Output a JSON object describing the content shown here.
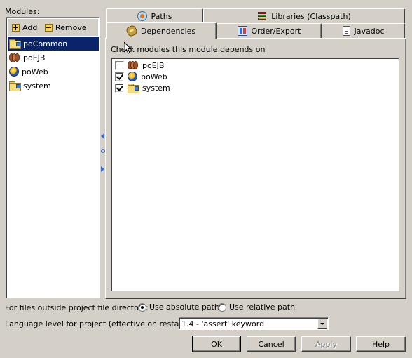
{
  "modules": {
    "label": "Modules:",
    "add_label": "Add",
    "remove_label": "Remove",
    "items": [
      {
        "name": "poCommon",
        "icon": "folder-module-icon",
        "selected": true
      },
      {
        "name": "poEJB",
        "icon": "ejb-beans-icon"
      },
      {
        "name": "poWeb",
        "icon": "web-globe-icon"
      },
      {
        "name": "system",
        "icon": "folder-module-icon"
      }
    ]
  },
  "tabs": {
    "paths": "Paths",
    "libraries": "Libraries (Classpath)",
    "dependencies": "Dependencies",
    "order_export": "Order/Export",
    "javadoc": "Javadoc",
    "active": "Dependencies"
  },
  "dependencies": {
    "label": "Check modules this module depends on",
    "items": [
      {
        "name": "poEJB",
        "checked": false
      },
      {
        "name": "poWeb",
        "checked": true
      },
      {
        "name": "system",
        "checked": true
      }
    ]
  },
  "files_outside": {
    "label": "For files outside project file directory:",
    "absolute": "Use absolute path",
    "relative": "Use relative path",
    "selected": "absolute"
  },
  "language_level": {
    "label": "Language level for project (effective on restart):",
    "value": "1.4 - 'assert' keyword"
  },
  "buttons": {
    "ok": "OK",
    "cancel": "Cancel",
    "apply": "Apply",
    "help": "Help"
  },
  "colors": {
    "dialog_bg": "#d4d0c8",
    "selection": "#0a246a"
  }
}
